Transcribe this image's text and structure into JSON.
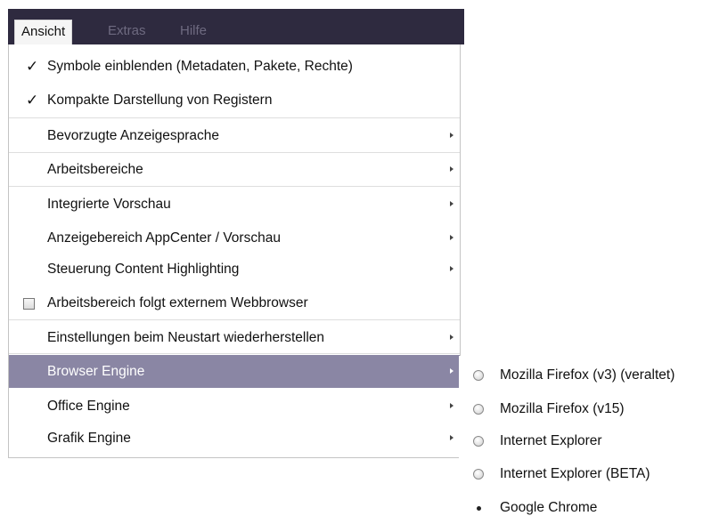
{
  "menubar": {
    "items": [
      {
        "label": "Ansicht",
        "active": true
      },
      {
        "label": "Extras",
        "active": false
      },
      {
        "label": "Hilfe",
        "active": false
      }
    ]
  },
  "menu": {
    "items": [
      {
        "label": "Symbole einblenden (Metadaten, Pakete, Rechte)",
        "marker": "check"
      },
      {
        "label": "Kompakte Darstellung von Registern",
        "marker": "check"
      },
      {
        "label": "Bevorzugte Anzeigesprache",
        "submenu": true
      },
      {
        "label": "Arbeitsbereiche",
        "submenu": true
      },
      {
        "label": "Integrierte Vorschau",
        "submenu": true
      },
      {
        "label": "Anzeigebereich AppCenter / Vorschau",
        "submenu": true
      },
      {
        "label": "Steuerung Content Highlighting",
        "submenu": true
      },
      {
        "label": "Arbeitsbereich folgt externem Webbrowser",
        "marker": "checkbox-unchecked"
      },
      {
        "label": "Einstellungen beim Neustart wiederherstellen",
        "submenu": true
      },
      {
        "label": "Browser Engine",
        "submenu": true,
        "highlighted": true
      },
      {
        "label": "Office Engine",
        "submenu": true
      },
      {
        "label": "Grafik Engine",
        "submenu": true
      }
    ],
    "check_symbol": "✓"
  },
  "submenu": {
    "items": [
      {
        "label": "Mozilla Firefox (v3) (veraltet)",
        "selected": false
      },
      {
        "label": "Mozilla Firefox (v15)",
        "selected": false
      },
      {
        "label": "Internet Explorer",
        "selected": false
      },
      {
        "label": "Internet Explorer (BETA)",
        "selected": false
      },
      {
        "label": "Google Chrome",
        "selected": true
      }
    ]
  },
  "colors": {
    "menubar_bg": "#2e2a3f",
    "highlight_bg": "#8a86a4",
    "inactive_menubar_text": "#6e6a80"
  }
}
